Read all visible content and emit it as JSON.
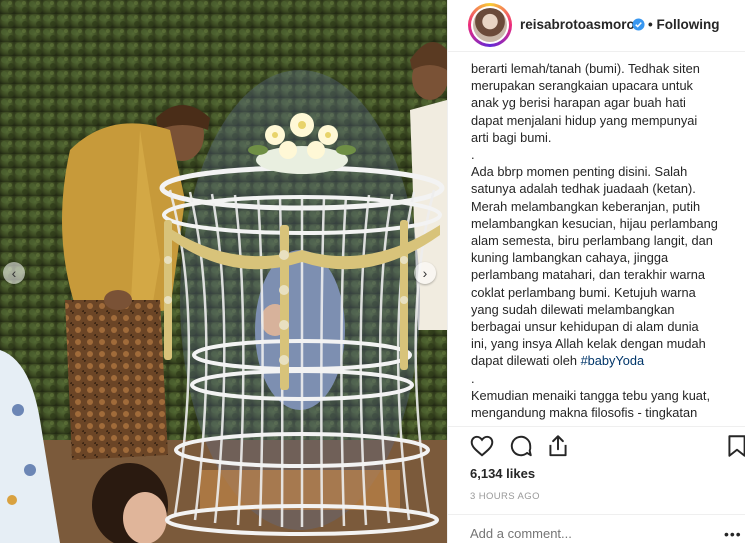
{
  "post": {
    "username": "reisabrotoasmoro",
    "separator": "•",
    "follow_status": "Following",
    "verified_icon": "verified-badge-icon",
    "caption_lines": [
      "berarti lemah/tanah (bumi). Tedhak siten",
      "merupakan serangkaian upacara untuk",
      "anak yg berisi harapan agar buah hati",
      "dapat menjalani hidup yang mempunyai",
      "arti bagi bumi.",
      ".",
      "Ada bbrp momen penting disini. Salah",
      "satunya adalah tedhak juadaah (ketan).",
      "Merah melambangkan keberanjan, putih",
      "melambangkan kesucian, hijau perlambang",
      "alam semesta, biru perlambang langit, dan",
      "kuning lambangkan cahaya, jingga",
      "perlambang matahari, dan terakhir warna",
      "coklat perlambang bumi. Ketujuh warna",
      "yang sudah dilewati melambangkan",
      "berbagai unsur kehidupan di alam dunia",
      "ini, yang insya Allah kelak dengan mudah",
      "dapat dilewati oleh ",
      ".",
      "Kemudian menaiki tangga tebu yang kuat,",
      "mengandung makna filosofis - tingkatan"
    ],
    "hashtag": "#babyYoda",
    "likes": "6,134 likes",
    "time": "3 HOURS AGO",
    "comment_placeholder": "Add a comment...",
    "more": "•••"
  },
  "carousel": {
    "prev": "‹",
    "next": "›"
  },
  "colors": {
    "text": "#262626",
    "muted": "#999999",
    "link": "#003569",
    "verified": "#3897f0"
  }
}
